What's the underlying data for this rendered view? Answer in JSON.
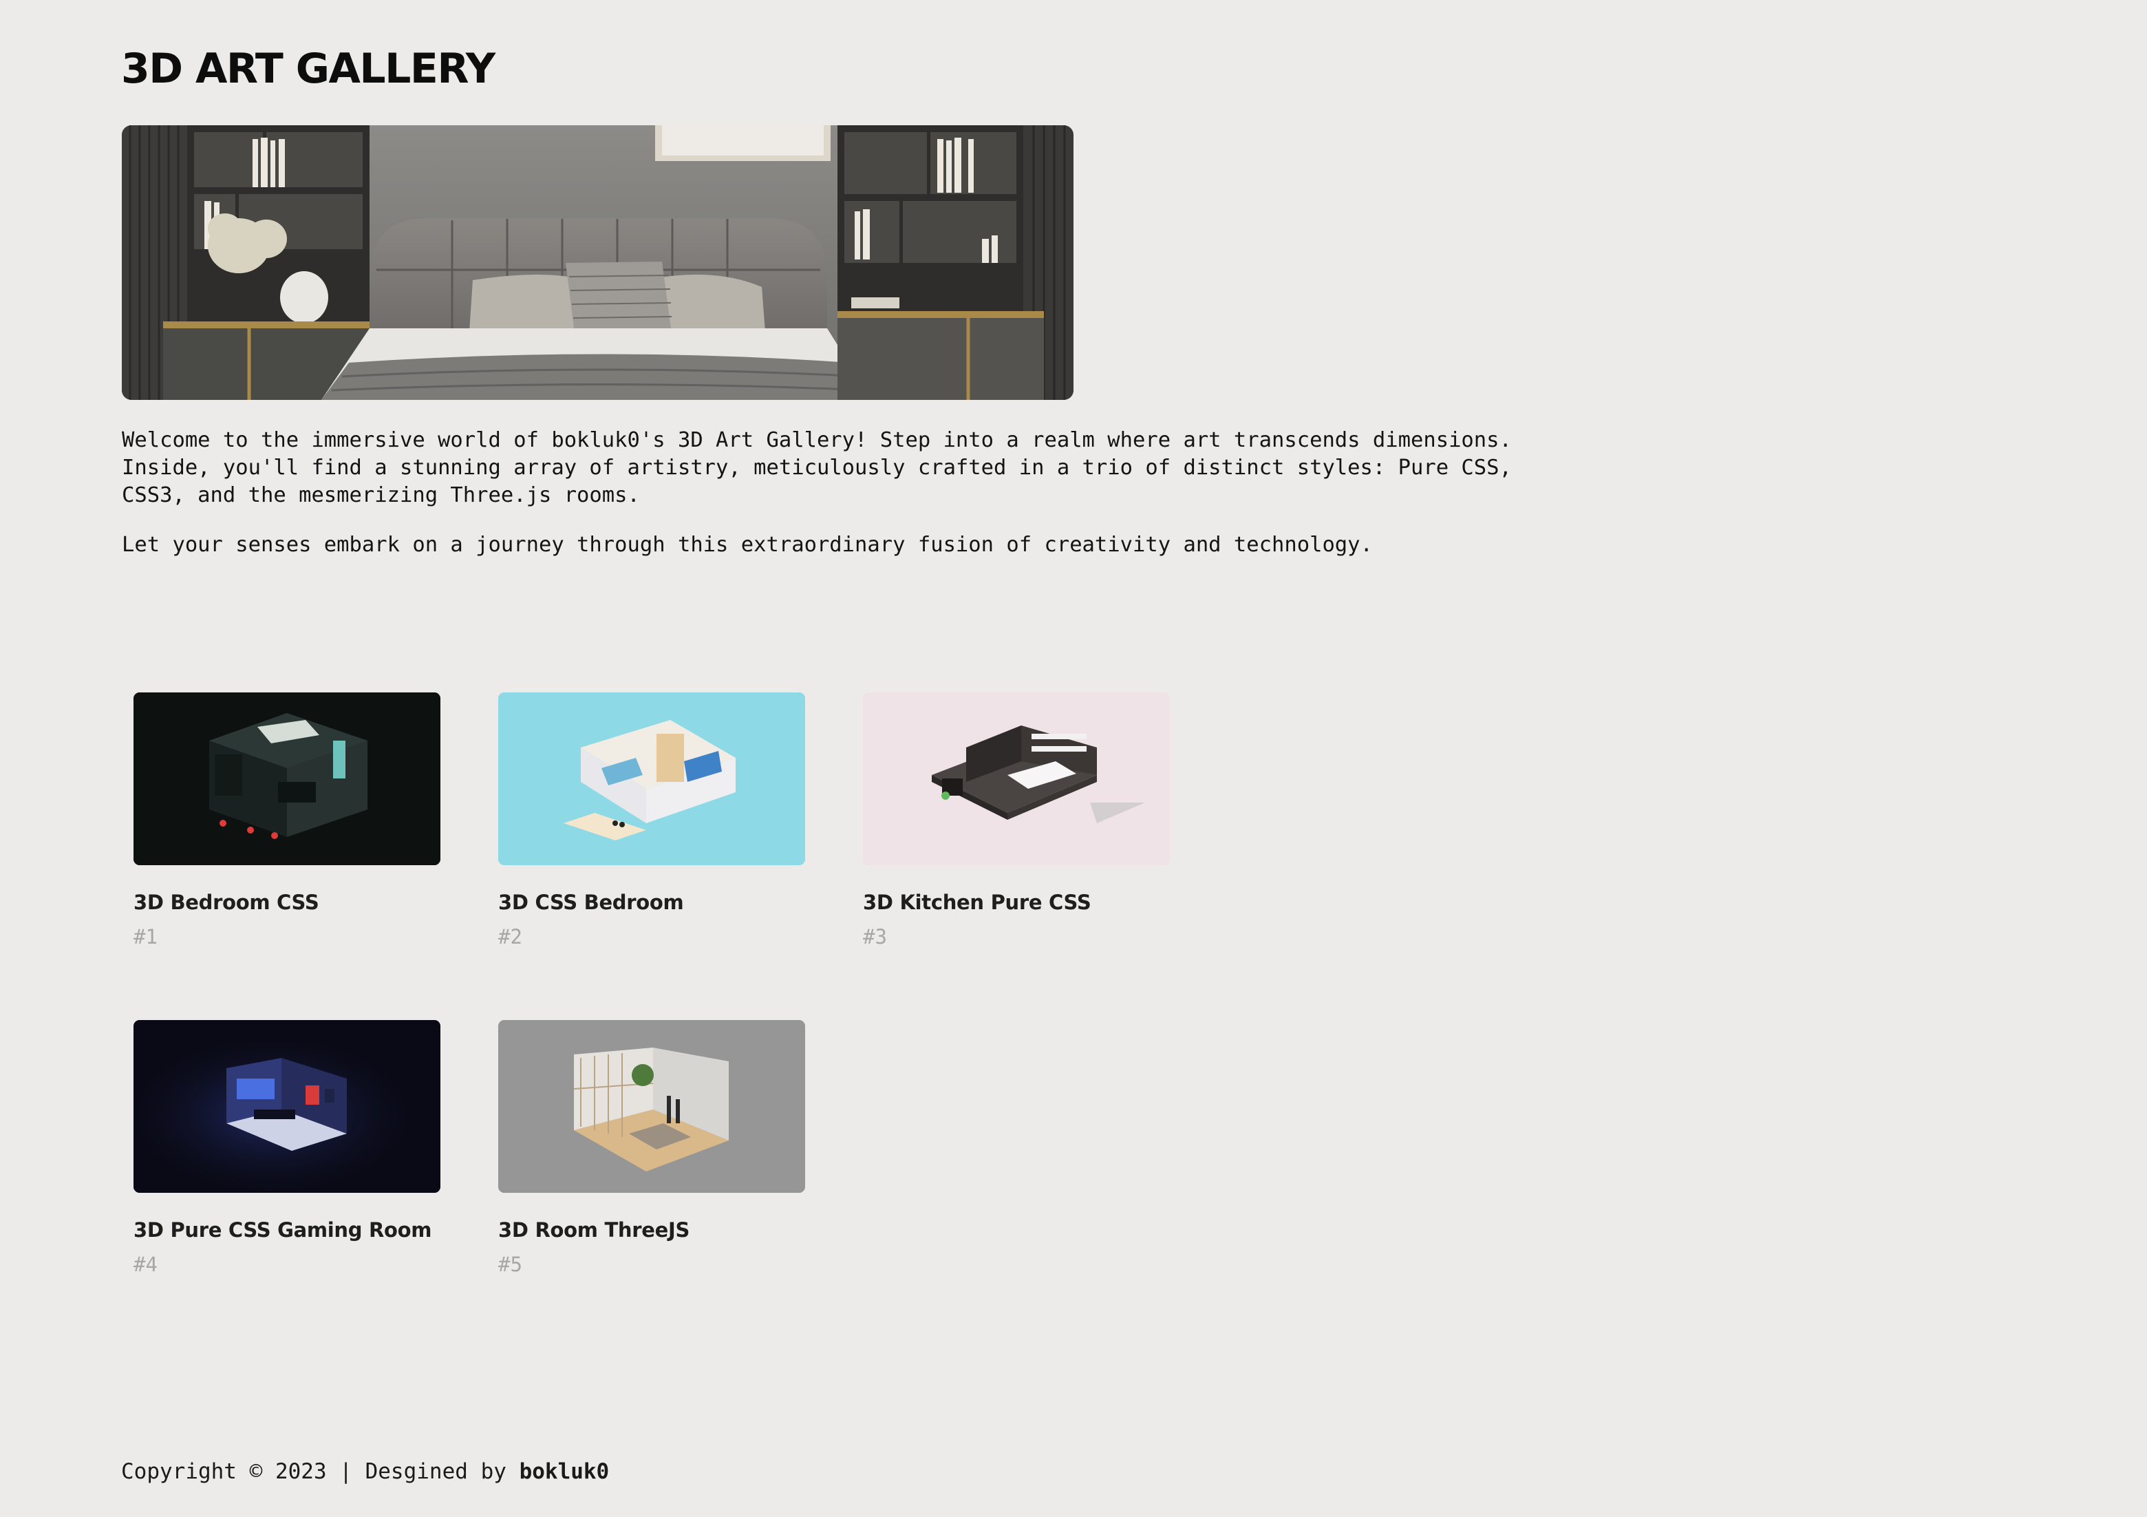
{
  "header": {
    "title": "3D ART GALLERY"
  },
  "intro": {
    "paragraph1": "Welcome to the immersive world of bokluk0's 3D Art Gallery! Step into a realm where art transcends dimensions. Inside, you'll find a stunning array of artistry, meticulously crafted in a trio of distinct styles: Pure CSS, CSS3, and the mesmerizing Three.js rooms.",
    "paragraph2": "Let your senses embark on a journey through this extraordinary fusion of creativity and technology."
  },
  "gallery": {
    "items": [
      {
        "title": "3D Bedroom CSS",
        "number": "#1",
        "bg": "#0d110f"
      },
      {
        "title": "3D CSS Bedroom",
        "number": "#2",
        "bg": "#8ed9e6"
      },
      {
        "title": "3D Kitchen Pure CSS",
        "number": "#3",
        "bg": "#efe3e7"
      },
      {
        "title": "3D Pure CSS Gaming Room",
        "number": "#4",
        "bg": "#0a0a16"
      },
      {
        "title": "3D Room ThreeJS",
        "number": "#5",
        "bg": "#969696"
      }
    ]
  },
  "footer": {
    "text": "Copyright © 2023 | Desgined by ",
    "author": "bokluk0"
  }
}
